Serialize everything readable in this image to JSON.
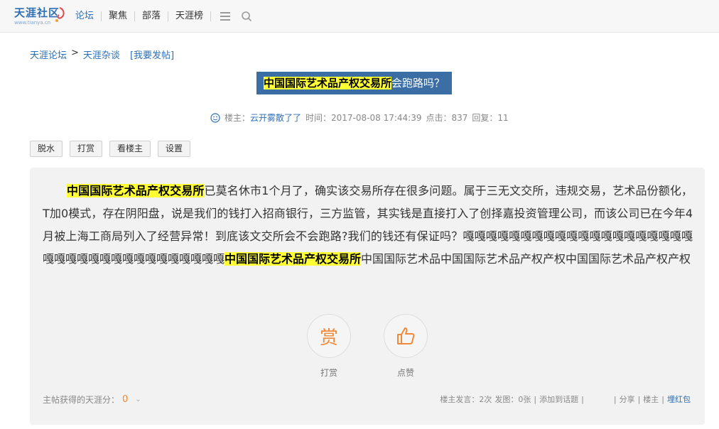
{
  "site": {
    "logo_text": "天涯社区",
    "logo_url": "www.tianya.cn",
    "nav": [
      {
        "label": "论坛"
      },
      {
        "label": "聚焦"
      },
      {
        "label": "部落"
      },
      {
        "label": "天涯榜"
      }
    ],
    "icons": [
      "menu-icon",
      "search-icon"
    ]
  },
  "breadcrumb": {
    "home": "天涯论坛",
    "separator": ">",
    "board": "天涯杂谈",
    "post_link": "[我要发帖]"
  },
  "post": {
    "title_highlight": "中国国际艺术品产权交易所",
    "title_rest": "会跑路吗？",
    "meta": {
      "author_label": "楼主：",
      "author": "云开雾散了了",
      "time": "时间：2017-08-08 17:44:39",
      "clicks": "点击：837",
      "replies": "回复：11"
    },
    "buttons": [
      "脱水",
      "打赏",
      "看楼主",
      "设置"
    ],
    "body_parts": [
      {
        "text": "中国国际艺术品产权交易所",
        "highlight": true
      },
      {
        "text": "已莫名休市1个月了，确实该交易所存在很多问题。属于三无文交所，违规交易，艺术品份额化，T加0模式，存在阴阳盘，说是我们的钱打入招商银行，三方监管，其实钱是直接打入了创择嘉投资管理公司，而该公司已在今年4月被上海工商局列入了经营异常！到底该文交所会不会跑路?我们的钱还有保证吗？嘎嘎嘎嘎嘎嘎嘎嘎嘎嘎嘎嘎嘎嘎嘎嘎嘎嘎嘎嘎嘎嘎嘎嘎嘎嘎嘎嘎嘎嘎嘎嘎嘎嘎嘎嘎",
        "highlight": false
      },
      {
        "text": "中国国际艺术品产权交易所",
        "highlight": true
      },
      {
        "text": "中国国际艺术品中国国际艺术品产权产权中国国际艺术品产权产权",
        "highlight": false
      }
    ],
    "actions": {
      "reward_glyph": "赏",
      "reward_label": "打赏",
      "like_label": "点赞"
    },
    "score": {
      "label": "主帖获得的天涯分：",
      "value": "0"
    },
    "stats": {
      "owner_posts": "楼主发言：2次",
      "images": "发图：0张",
      "add_topic": "添加到话题",
      "share": "分享",
      "owner": "楼主",
      "red_packet": "埋红包"
    }
  },
  "colors": {
    "accent": "#2f6fb5",
    "title_bg": "#3a6ea5",
    "highlight": "#ffff33",
    "orange": "#f08a3a"
  }
}
